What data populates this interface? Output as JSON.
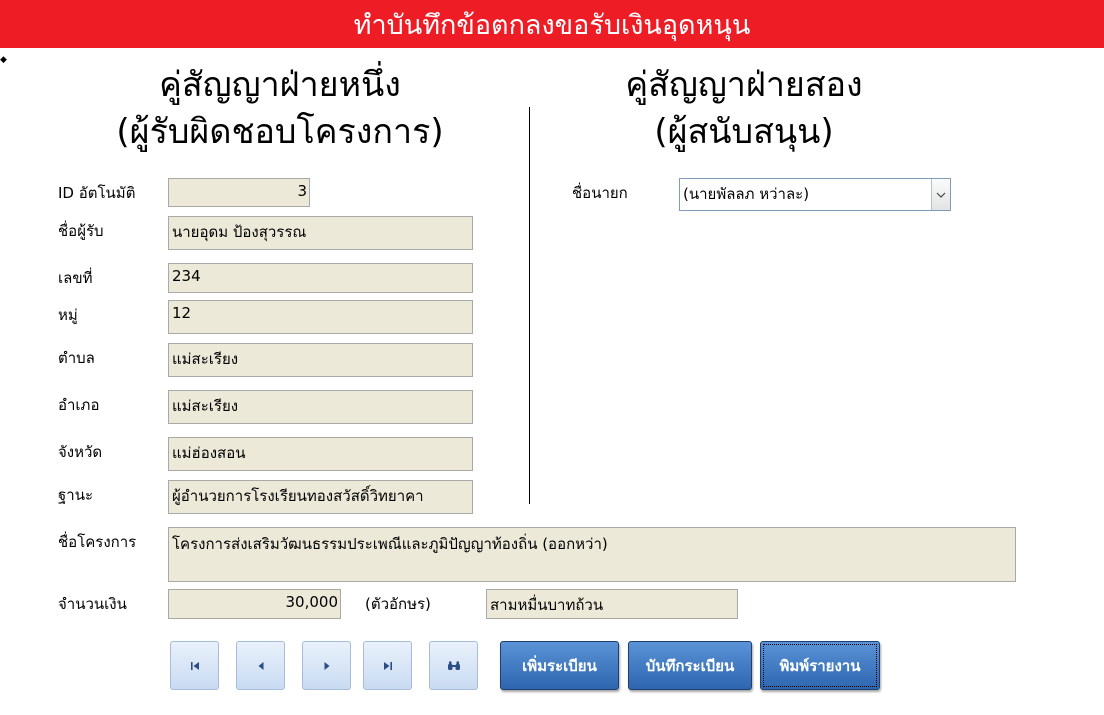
{
  "title": "ทำบันทึกข้อตกลงขอรับเงินอุดหนุน",
  "party_one": {
    "heading_line1": "คู่สัญญาฝ่ายหนึ่ง",
    "heading_line2": "(ผู้รับผิดชอบโครงการ)"
  },
  "party_two": {
    "heading_line1": "คู่สัญญาฝ่ายสอง",
    "heading_line2": "(ผู้สนับสนุน)"
  },
  "fields": {
    "id": {
      "label": "ID อัตโนมัติ",
      "value": "3"
    },
    "recipient_name": {
      "label": "ชื่อผู้รับ",
      "value": "นายอุดม  ป้องสุวรรณ"
    },
    "house_no": {
      "label": "เลขที่",
      "value": "234"
    },
    "village": {
      "label": "หมู่",
      "value": "12"
    },
    "subdistrict": {
      "label": "ตำบล",
      "value": "แม่สะเรียง"
    },
    "district": {
      "label": "อำเภอ",
      "value": "แม่สะเรียง"
    },
    "province": {
      "label": "จังหวัด",
      "value": "แม่ฮ่องสอน"
    },
    "position": {
      "label": "ฐานะ",
      "value": "ผู้อำนวยการโรงเรียนทองสวัสดิ์วิทยาคา"
    },
    "mayor": {
      "label": "ชื่อนายก",
      "value": "(นายพัลลภ  หว่าละ)"
    },
    "project_name": {
      "label": "ชื่อโครงการ",
      "value": "โครงการส่งเสริมวัฒนธรรมประเพณีและภูมิปัญญาท้องถิ่น (ออกหว่า)"
    },
    "amount": {
      "label": "จำนวนเงิน",
      "value": "30,000"
    },
    "amount_text": {
      "label": "(ตัวอักษร)",
      "value": "สามหมื่นบาทถ้วน"
    }
  },
  "nav_buttons": [
    {
      "name": "first-record-button",
      "icon": "first-record-icon"
    },
    {
      "name": "previous-record-button",
      "icon": "previous-record-icon"
    },
    {
      "name": "next-record-button",
      "icon": "next-record-icon"
    },
    {
      "name": "last-record-button",
      "icon": "last-record-icon"
    },
    {
      "name": "find-record-button",
      "icon": "binoculars-icon"
    }
  ],
  "actions": {
    "add_label": "เพิ่มระเบียน",
    "save_label": "บันทึกระเบียน",
    "print_label": "พิมพ์รายงาน"
  },
  "colors": {
    "title_bar": "#ee1c25",
    "field_background": "#ece9d8",
    "command_button": "#3a73bf"
  }
}
